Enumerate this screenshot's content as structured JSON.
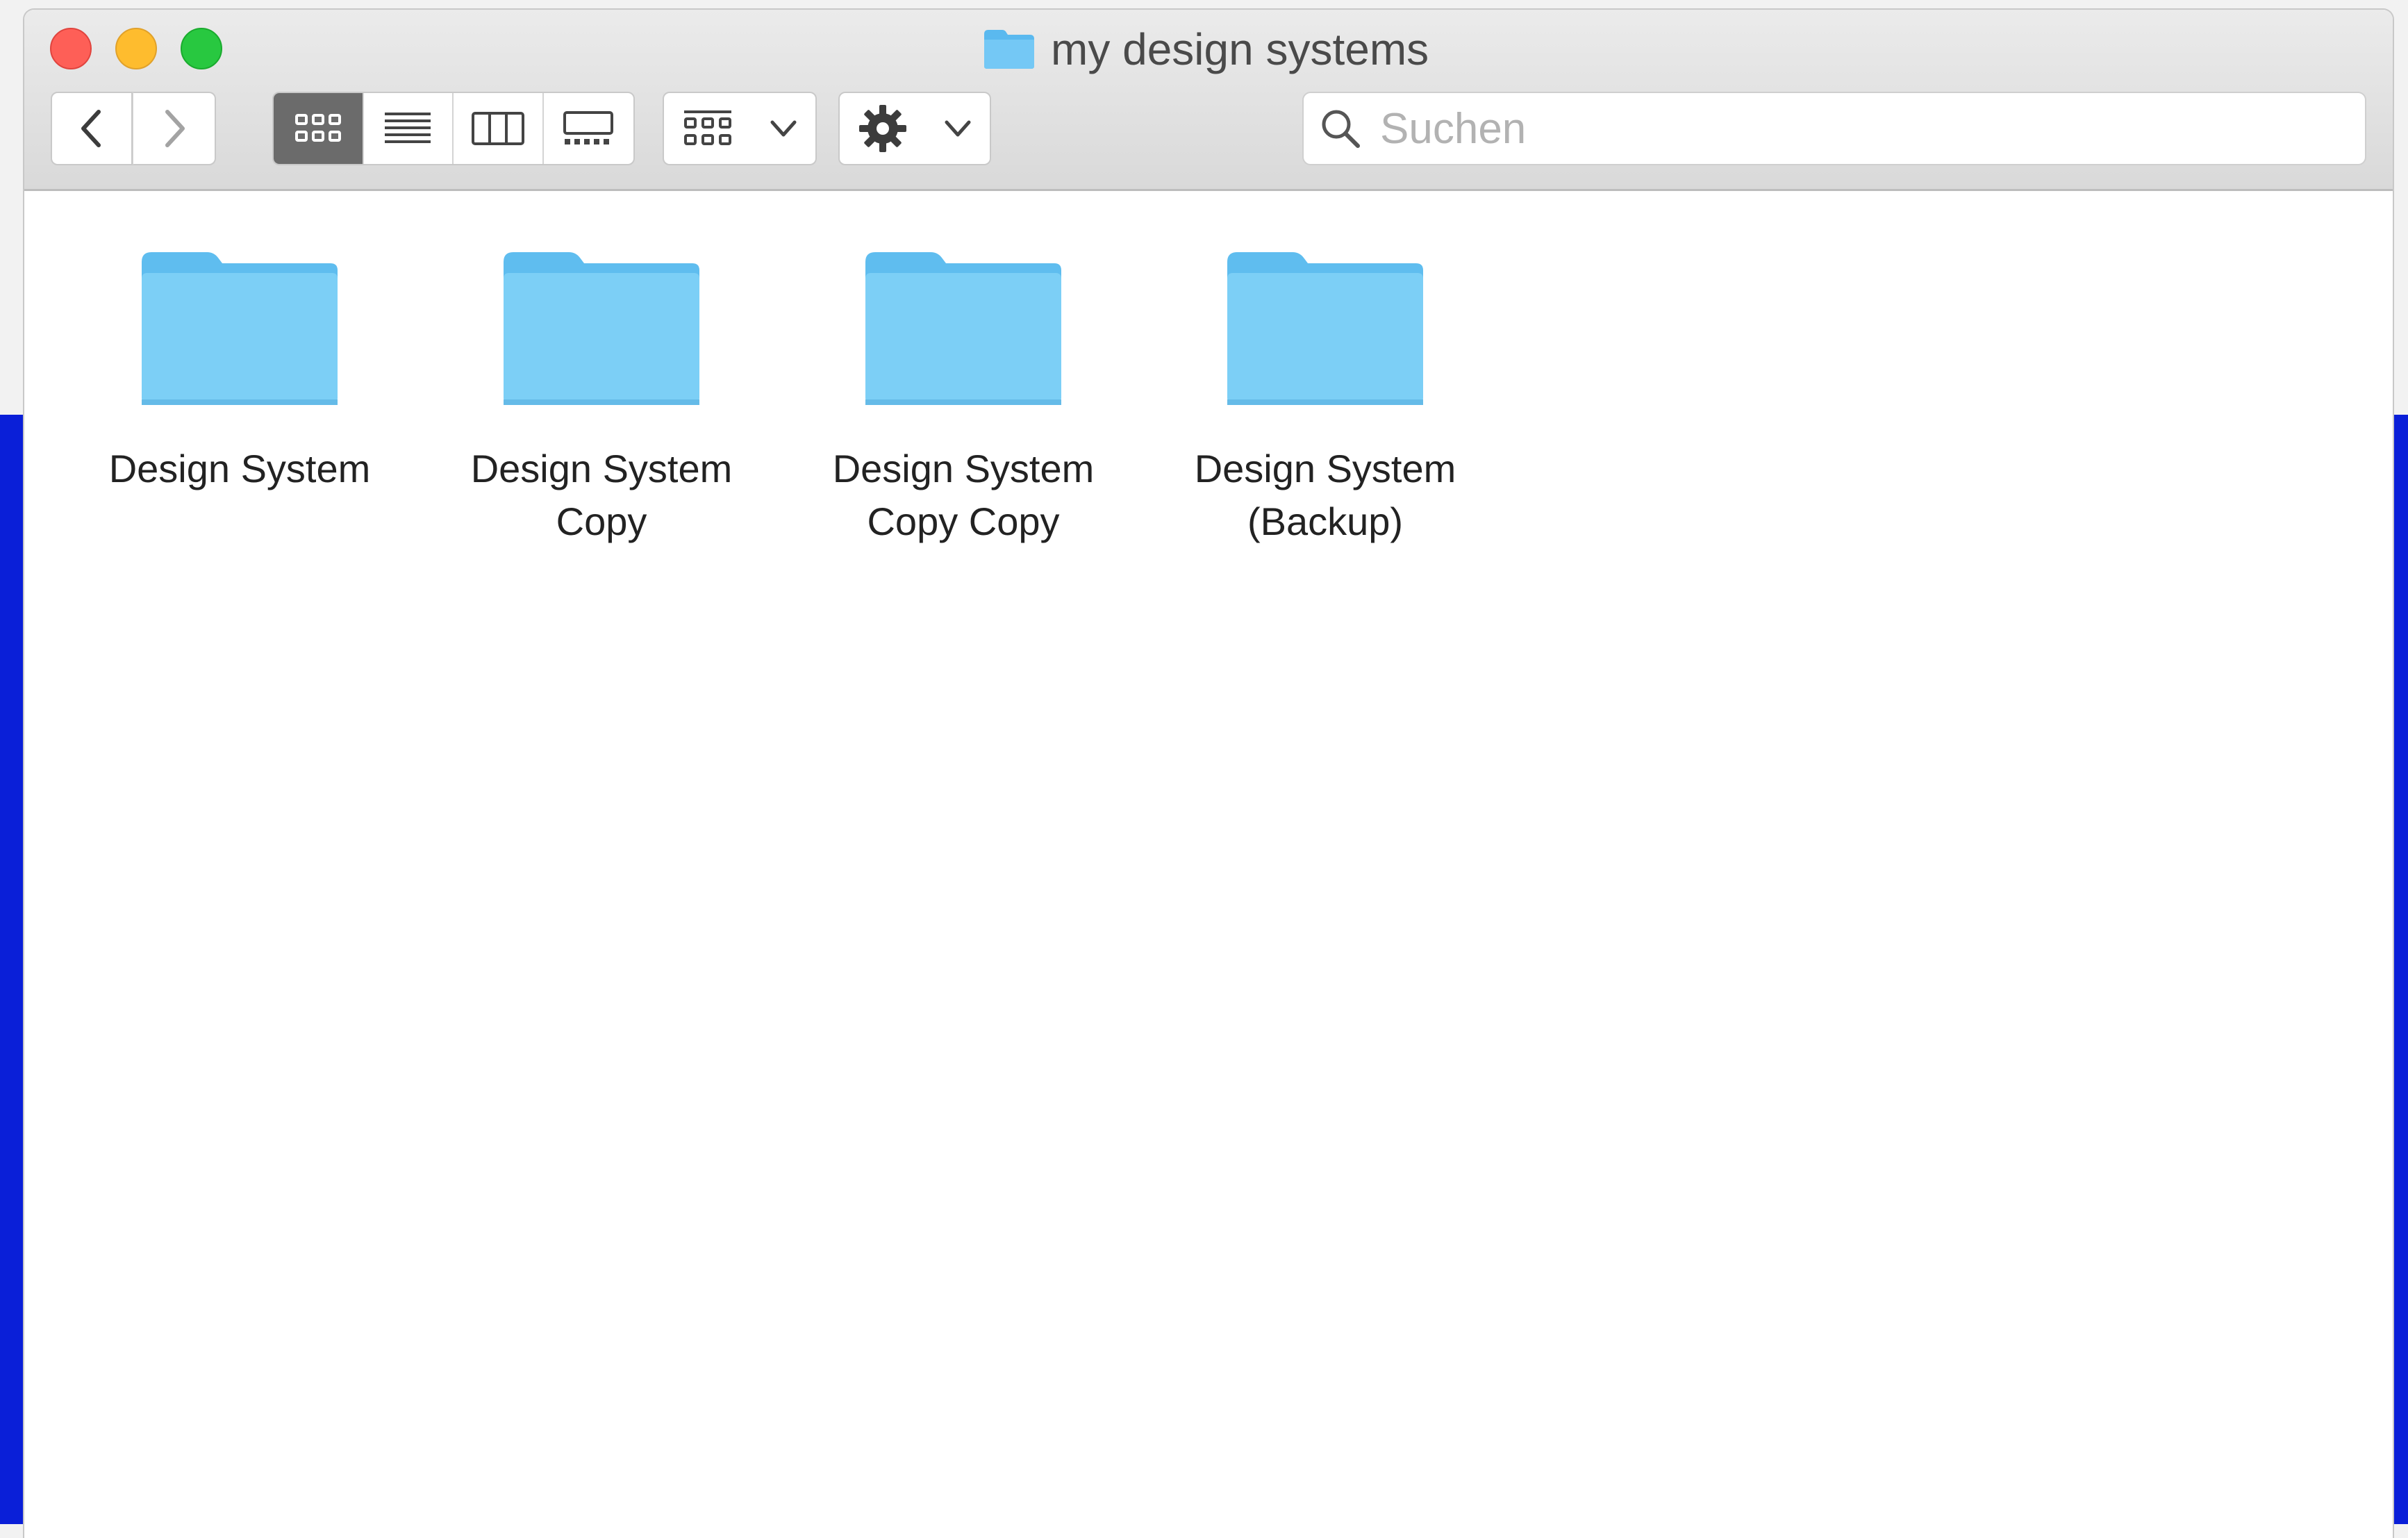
{
  "window": {
    "title": "my design systems"
  },
  "toolbar": {
    "back_icon": "chevron-left-icon",
    "forward_icon": "chevron-right-icon",
    "view_modes": [
      "icon-view",
      "list-view",
      "column-view",
      "gallery-view"
    ],
    "active_view": "icon-view",
    "group_icon": "grid-group-icon",
    "action_icon": "gear-icon"
  },
  "search": {
    "placeholder": "Suchen",
    "value": ""
  },
  "items": [
    {
      "label": "Design System"
    },
    {
      "label": "Design System\nCopy"
    },
    {
      "label": "Design System\nCopy Copy"
    },
    {
      "label": "Design System\n(Backup)"
    }
  ],
  "colors": {
    "folder": "#7ccff6",
    "desktop": "#0a1fd8"
  }
}
